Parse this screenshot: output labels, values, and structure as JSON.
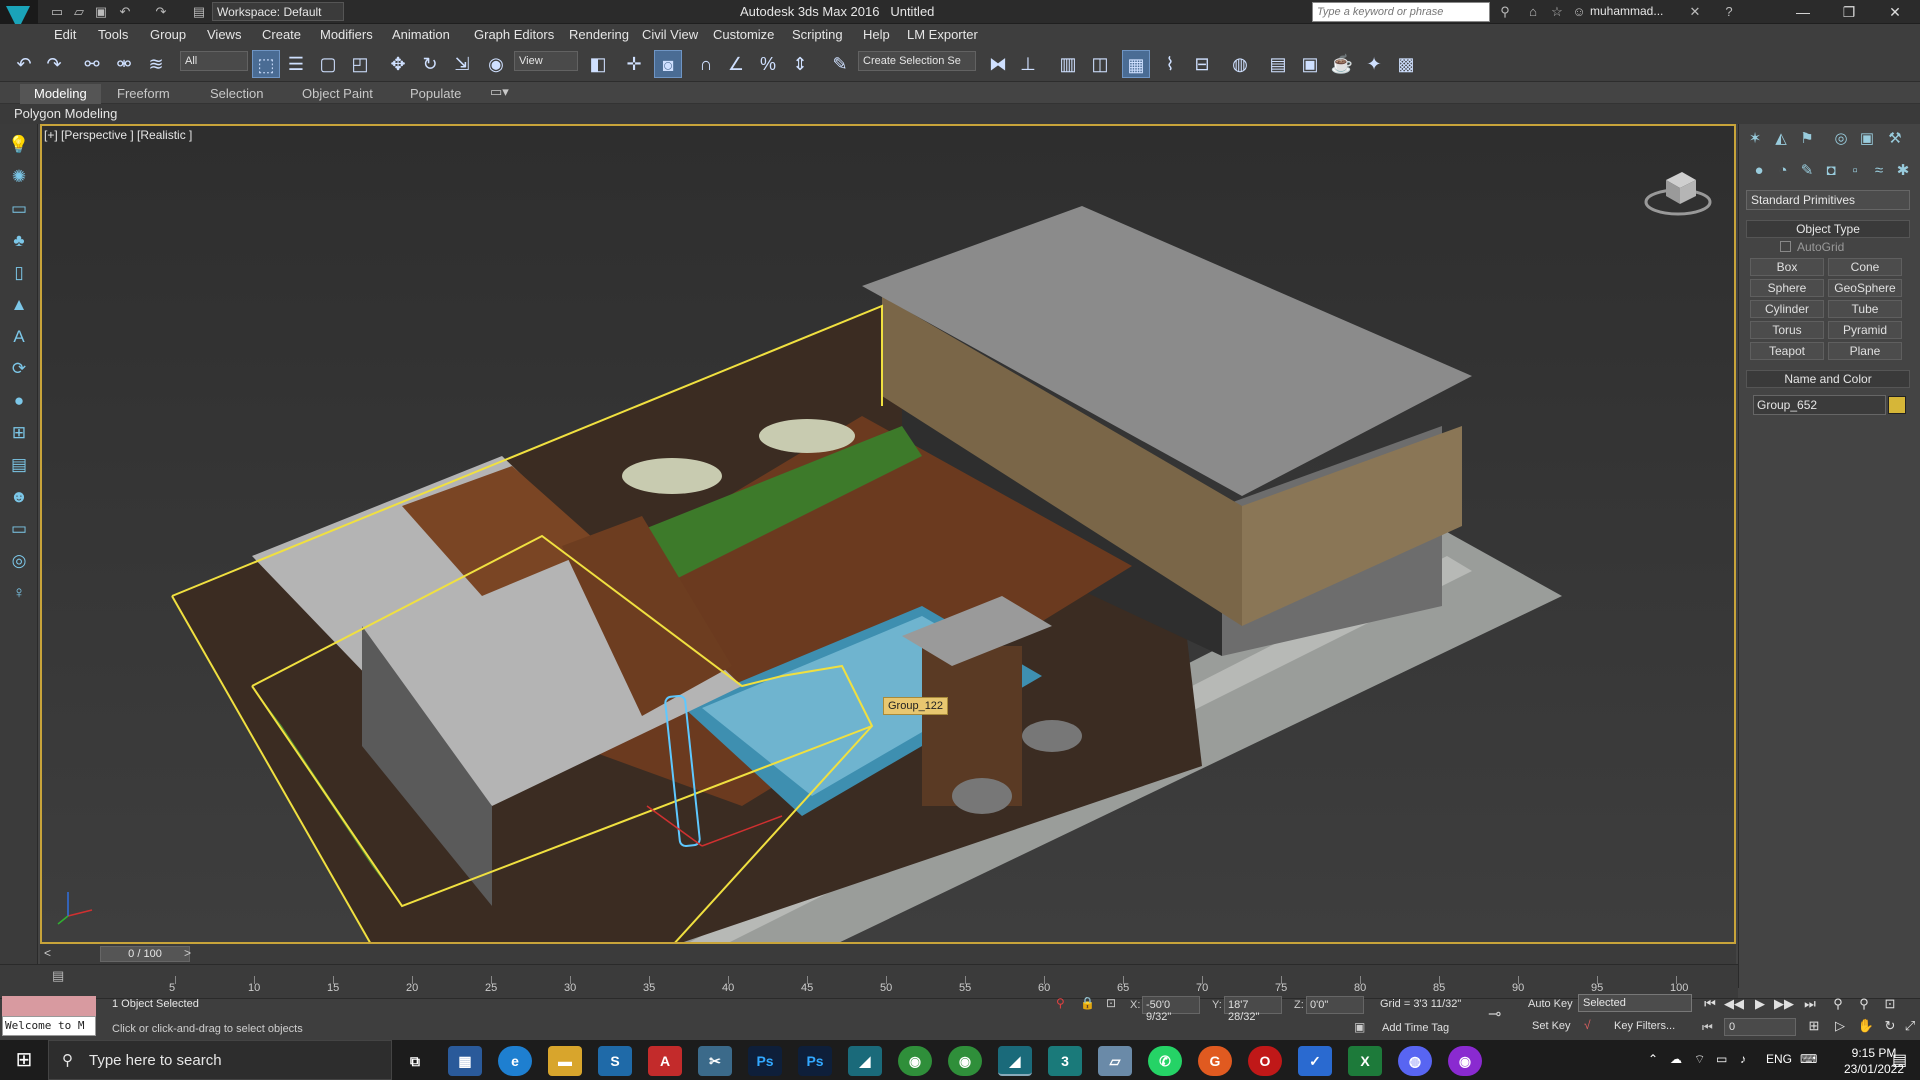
{
  "window": {
    "app_title": "Autodesk 3ds Max 2016",
    "doc_title": "Untitled",
    "workspace": "Workspace: Default",
    "search_placeholder": "Type a keyword or phrase",
    "user": "muhammad..."
  },
  "menu": [
    "Edit",
    "Tools",
    "Group",
    "Views",
    "Create",
    "Modifiers",
    "Animation",
    "Graph Editors",
    "Rendering",
    "Civil View",
    "Customize",
    "Scripting",
    "Help",
    "LM Exporter"
  ],
  "toolbar": {
    "filter": "All",
    "ref_coord": "View",
    "selection_set": "Create Selection Se"
  },
  "ribbon": {
    "tabs": [
      "Modeling",
      "Freeform",
      "Selection",
      "Object Paint",
      "Populate"
    ],
    "active": "Modeling",
    "sub": "Polygon Modeling"
  },
  "viewport": {
    "label": "[+] [Perspective ] [Realistic ]",
    "object_tooltip": "Group_122"
  },
  "command_panel": {
    "category": "Standard Primitives",
    "object_type_header": "Object Type",
    "autogrid": "AutoGrid",
    "primitives": [
      "Box",
      "Cone",
      "Sphere",
      "GeoSphere",
      "Cylinder",
      "Tube",
      "Torus",
      "Pyramid",
      "Teapot",
      "Plane"
    ],
    "name_color_header": "Name and Color",
    "object_name": "Group_652",
    "object_color": "#d6b638"
  },
  "timeline": {
    "frame_slider": "0 / 100",
    "ticks": [
      "5",
      "10",
      "15",
      "20",
      "25",
      "30",
      "35",
      "40",
      "45",
      "50",
      "55",
      "60",
      "65",
      "70",
      "75",
      "80",
      "85",
      "90",
      "95",
      "100"
    ]
  },
  "status": {
    "welcome": "Welcome to M",
    "selected": "1 Object Selected",
    "prompt": "Click or click-and-drag to select objects",
    "x": "-50'0 9/32\"",
    "y": "18'7 28/32\"",
    "z": "0'0\"",
    "grid": "Grid = 3'3 11/32\"",
    "add_time_tag": "Add Time Tag",
    "auto_key": "Auto Key",
    "set_key": "Set Key",
    "key_mode": "Selected",
    "key_filters": "Key Filters...",
    "frame": "0"
  },
  "taskbar": {
    "search": "Type here to search",
    "lang": "ENG",
    "time": "9:15 PM",
    "date": "23/01/2022"
  }
}
